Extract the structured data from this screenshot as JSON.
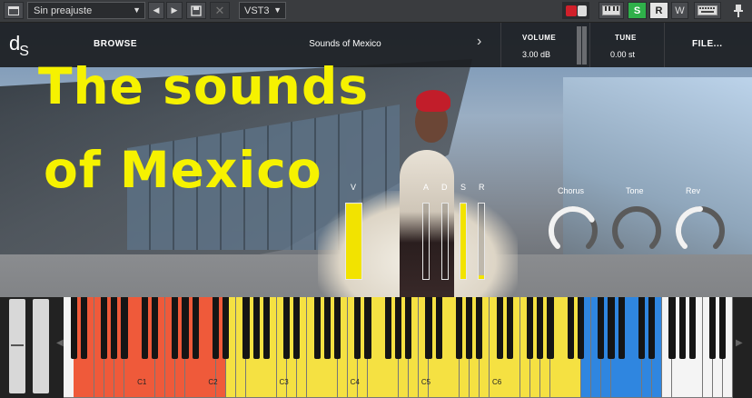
{
  "host": {
    "preset": "Sin preajuste",
    "nav_prev": "◀",
    "nav_next": "▶",
    "format": "VST3",
    "s_label": "S",
    "r_label": "R",
    "w_label": "W"
  },
  "header": {
    "logo_d": "d",
    "logo_s": "S",
    "browse": "BROWSE",
    "preset_name": "Sounds of Mexico",
    "volume_label": "VOLUME",
    "volume_value": "3.00 dB",
    "tune_label": "TUNE",
    "tune_value": "0.00 st",
    "file_label": "FILE..."
  },
  "overlay": {
    "line1": "The sounds",
    "line2": "of Mexico"
  },
  "sliders": {
    "v_label": "V",
    "a_label": "A",
    "d_label": "D",
    "s_label": "S",
    "r_label": "R",
    "values": {
      "v": 1.0,
      "a": 0.0,
      "d": 0.0,
      "s": 1.0,
      "r": 0.05
    }
  },
  "knobs": {
    "chorus_label": "Chorus",
    "tone_label": "Tone",
    "reverb_label": "Rev",
    "values": {
      "chorus": 0.72,
      "tone": 0.0,
      "reverb": 0.5
    }
  },
  "keyboard": {
    "octave_labels": [
      "C1",
      "C2",
      "C3",
      "C4",
      "C5",
      "C6"
    ],
    "colors": {
      "red": "#ef5a3a",
      "yellow": "#f5e142",
      "blue": "#2f86e0",
      "white": "#f4f4f4",
      "accent": "#f2e300"
    }
  }
}
